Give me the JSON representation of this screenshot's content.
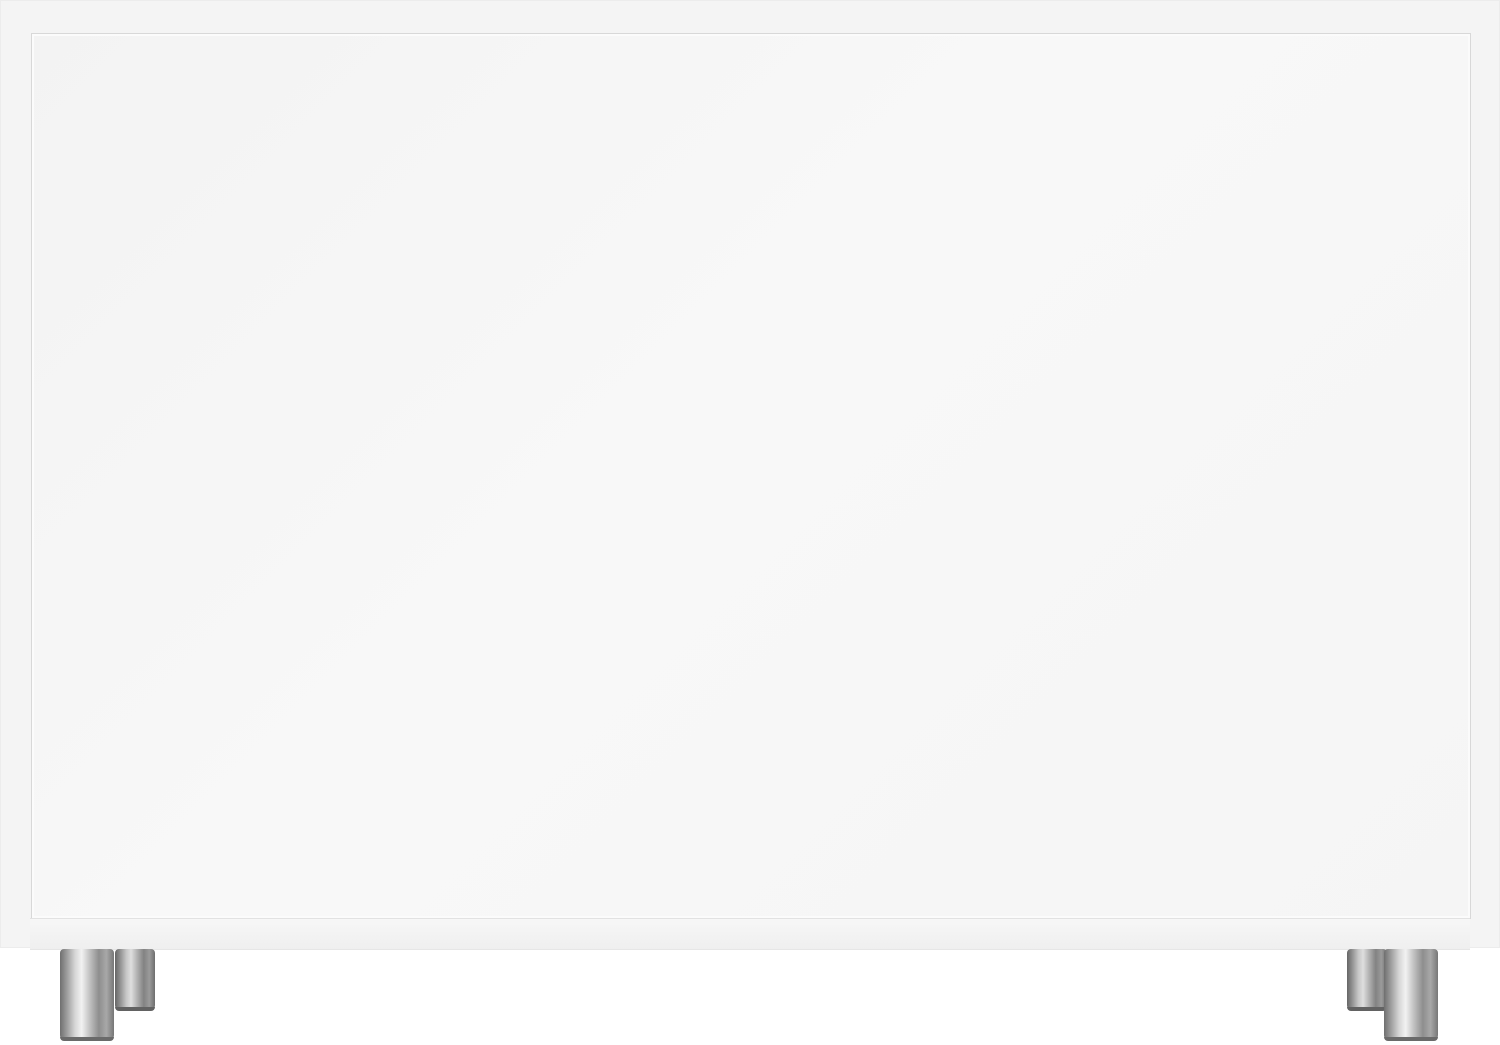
{
  "image": {
    "subject": "sideboard-cabinet-front-view",
    "colors": {
      "cabinet": "#f4f4f4",
      "front_panel": "#f6f6f6",
      "panel_edge": "#d8d8d8",
      "legs": "#a8a8a8",
      "background": "#ffffff"
    },
    "legs": [
      {
        "name": "front-left"
      },
      {
        "name": "back-left"
      },
      {
        "name": "back-right"
      },
      {
        "name": "front-right"
      }
    ]
  }
}
